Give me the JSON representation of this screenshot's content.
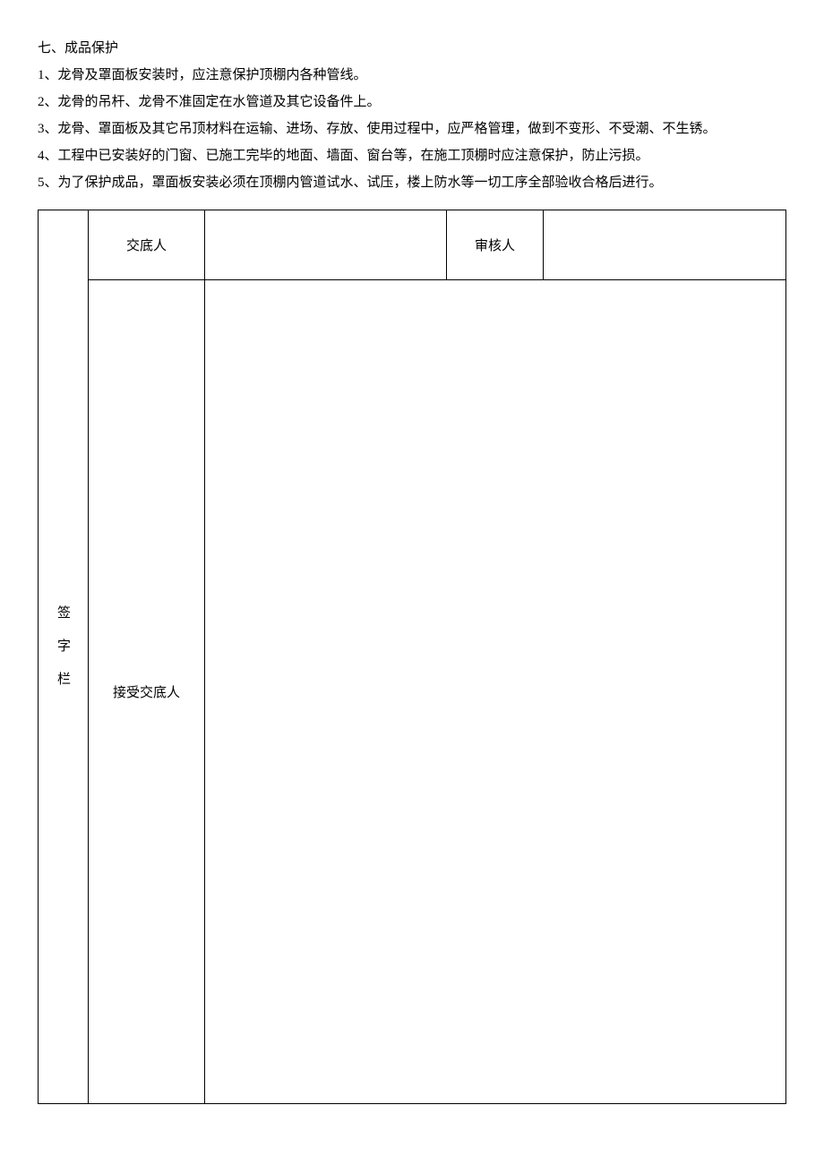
{
  "section": {
    "title": "七、成品保护",
    "items": [
      "1、龙骨及罩面板安装时，应注意保护顶棚内各种管线。",
      "2、龙骨的吊杆、龙骨不准固定在水管道及其它设备件上。",
      "3、龙骨、罩面板及其它吊顶材料在运输、进场、存放、使用过程中，应严格管理，做到不变形、不受潮、不生锈。",
      "4、工程中已安装好的门窗、已施工完毕的地面、墙面、窗台等，在施工顶棚时应注意保护，防止污损。",
      "5、为了保护成品，罩面板安装必须在顶棚内管道试水、试压，楼上防水等一切工序全部验收合格后进行。"
    ]
  },
  "table": {
    "side_label": "签字栏",
    "presenter_label": "交底人",
    "reviewer_label": "审核人",
    "receiver_label": "接受交底人",
    "presenter_value": "",
    "reviewer_value": "",
    "receiver_value": ""
  }
}
